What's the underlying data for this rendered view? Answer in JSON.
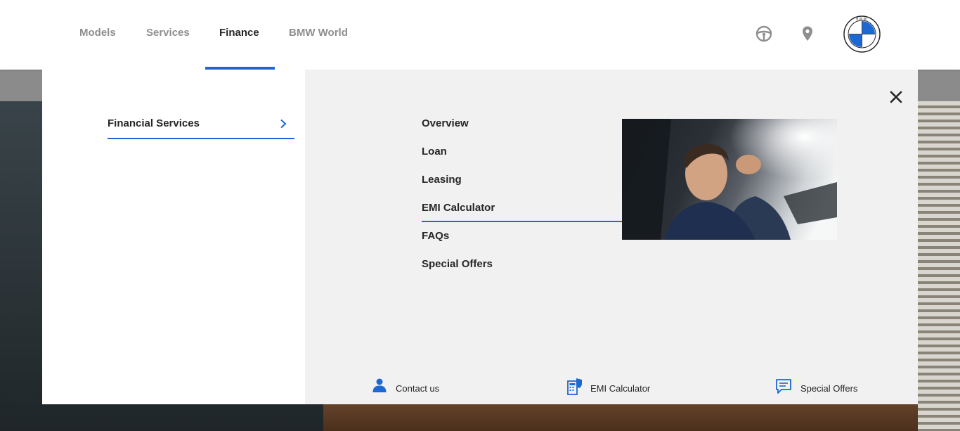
{
  "header": {
    "nav": [
      "Models",
      "Services",
      "Finance",
      "BMW World"
    ],
    "active_nav": "Finance",
    "logo_text": "BMW"
  },
  "panel": {
    "category": "Financial Services",
    "menu": [
      "Overview",
      "Loan",
      "Leasing",
      "EMI Calculator",
      "FAQs",
      "Special Offers"
    ],
    "selected_menu": "EMI Calculator",
    "footer_links": [
      "Contact us",
      "EMI Calculator",
      "Special Offers"
    ]
  },
  "colors": {
    "accent": "#1c69d4",
    "text": "#262626",
    "nav_inactive": "#8e8e8e",
    "panel_bg": "#f1f1f1"
  },
  "icons": [
    "steering-wheel-icon",
    "location-pin-icon",
    "bmw-logo",
    "chevron-right-icon",
    "close-icon",
    "person-icon",
    "calculator-icon",
    "chat-icon"
  ]
}
